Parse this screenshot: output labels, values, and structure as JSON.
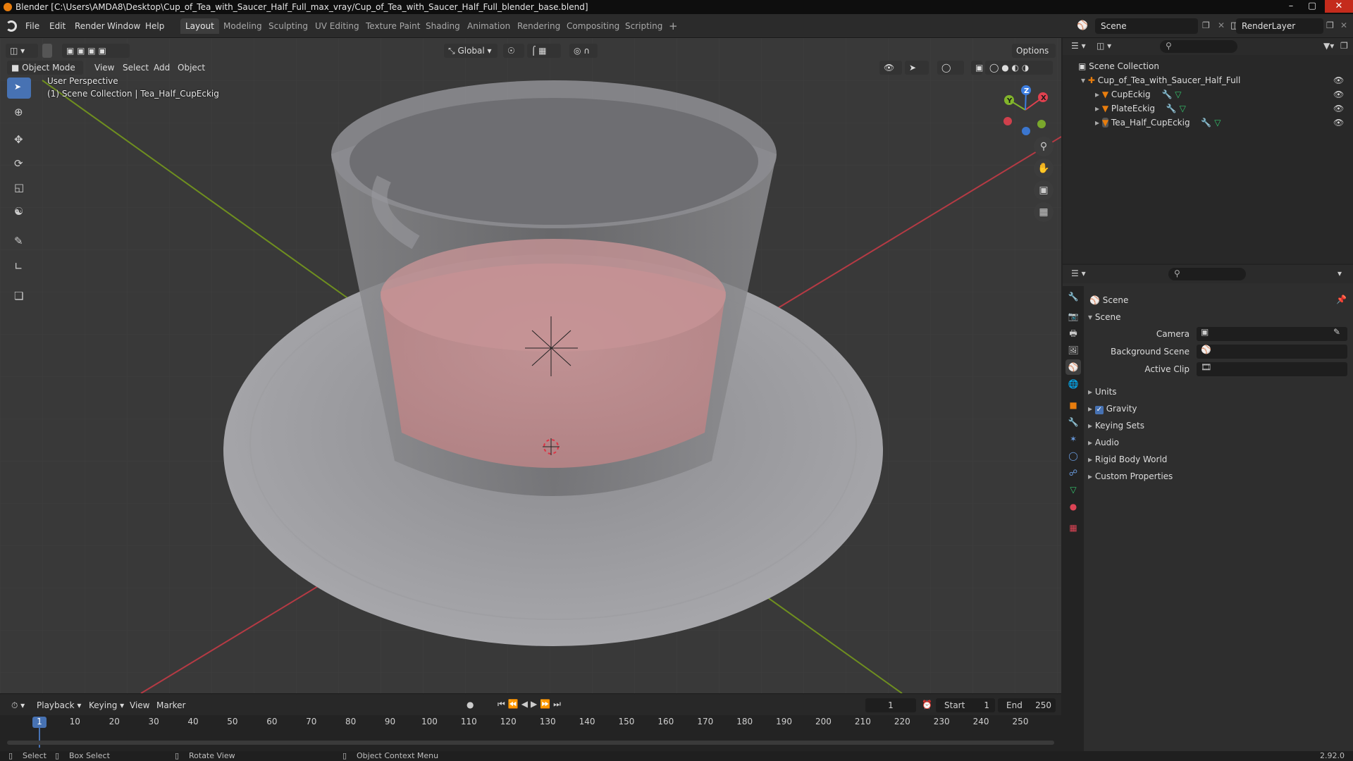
{
  "window": {
    "title": "Blender [C:\\Users\\AMDA8\\Desktop\\Cup_of_Tea_with_Saucer_Half_Full_max_vray/Cup_of_Tea_with_Saucer_Half_Full_blender_base.blend]",
    "minimize": "–",
    "maximize": "▢",
    "close": "✕"
  },
  "menu": {
    "file": "File",
    "edit": "Edit",
    "render": "Render",
    "window": "Window",
    "help": "Help"
  },
  "workspaces": [
    "Layout",
    "Modeling",
    "Sculpting",
    "UV Editing",
    "Texture Paint",
    "Shading",
    "Animation",
    "Rendering",
    "Compositing",
    "Scripting"
  ],
  "add_workspace": "+",
  "scene_name": "Scene",
  "render_layer": "RenderLayer",
  "viewport": {
    "mode": "Object Mode",
    "menus": [
      "View",
      "Select",
      "Add",
      "Object"
    ],
    "transform_orientation": "Global",
    "options": "Options",
    "perspective_label": "User Perspective",
    "collection_label": "(1) Scene Collection | Tea_Half_CupEckig",
    "gizmo_axes": {
      "x": "X",
      "y": "Y",
      "z": "Z"
    }
  },
  "outliner": {
    "root": "Scene Collection",
    "collection": "Cup_of_Tea_with_Saucer_Half_Full",
    "objects": [
      "CupEckig",
      "PlateEckig",
      "Tea_Half_CupEckig"
    ]
  },
  "properties": {
    "context": "Scene",
    "panel_title": "Scene",
    "camera_label": "Camera",
    "background_scene_label": "Background Scene",
    "active_clip_label": "Active Clip",
    "gravity_checked": true,
    "panels": [
      "Units",
      "Gravity",
      "Keying Sets",
      "Audio",
      "Rigid Body World",
      "Custom Properties"
    ]
  },
  "timeline": {
    "menus": [
      "Playback",
      "Keying",
      "View",
      "Marker"
    ],
    "current_frame": "1",
    "start_label": "Start",
    "start": "1",
    "end_label": "End",
    "end": "250",
    "ticks": [
      "1",
      "10",
      "20",
      "30",
      "40",
      "50",
      "60",
      "70",
      "80",
      "90",
      "100",
      "110",
      "120",
      "130",
      "140",
      "150",
      "160",
      "170",
      "180",
      "190",
      "200",
      "210",
      "220",
      "230",
      "240",
      "250"
    ]
  },
  "statusbar": {
    "select": "Select",
    "box_select": "Box Select",
    "rotate_view": "Rotate View",
    "context_menu": "Object Context Menu",
    "version": "2.92.0"
  },
  "colors": {
    "accent_blue": "#4772b3",
    "axis_x": "#e0414f",
    "axis_y": "#82b52b",
    "axis_z": "#3c7de0",
    "object_orange": "#e87d0d",
    "mesh_green": "#35c46e"
  }
}
